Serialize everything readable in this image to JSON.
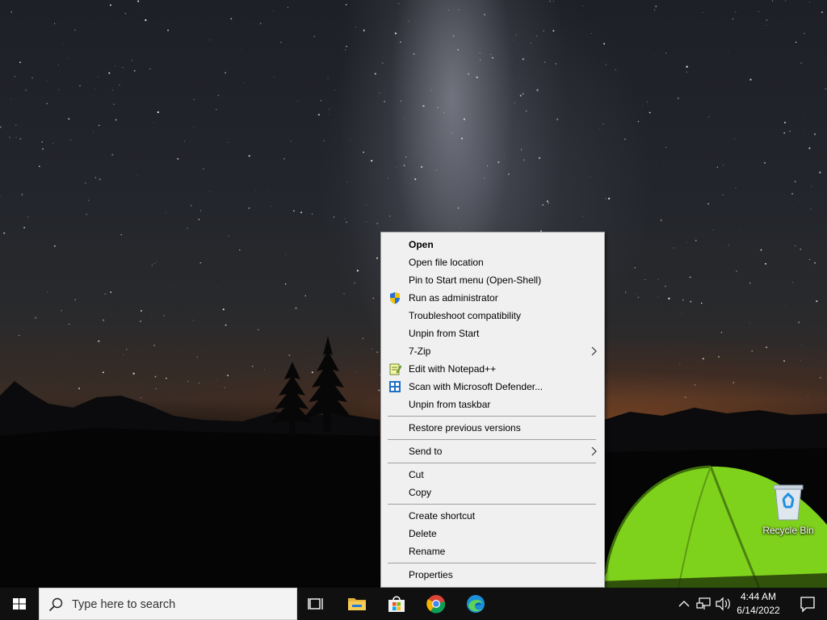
{
  "desktop": {
    "icons": [
      {
        "label": "Recycle Bin",
        "icon": "recycle-bin-icon"
      }
    ]
  },
  "context_menu": {
    "groups": [
      [
        {
          "label": "Open",
          "bold": true
        },
        {
          "label": "Open file location"
        },
        {
          "label": "Pin to Start menu (Open-Shell)"
        },
        {
          "label": "Run as administrator",
          "icon": "uac-shield-icon"
        },
        {
          "label": "Troubleshoot compatibility"
        },
        {
          "label": "Unpin from Start"
        },
        {
          "label": "7-Zip",
          "submenu": true
        },
        {
          "label": "Edit with Notepad++",
          "icon": "notepad-plus-plus-icon"
        },
        {
          "label": "Scan with Microsoft Defender...",
          "icon": "defender-icon"
        },
        {
          "label": "Unpin from taskbar"
        }
      ],
      [
        {
          "label": "Restore previous versions"
        }
      ],
      [
        {
          "label": "Send to",
          "submenu": true
        }
      ],
      [
        {
          "label": "Cut"
        },
        {
          "label": "Copy"
        }
      ],
      [
        {
          "label": "Create shortcut"
        },
        {
          "label": "Delete"
        },
        {
          "label": "Rename"
        }
      ],
      [
        {
          "label": "Properties"
        }
      ]
    ]
  },
  "taskbar": {
    "search_placeholder": "Type here to search",
    "pinned_apps": [
      "task-view-icon",
      "file-explorer-icon",
      "microsoft-store-icon",
      "chrome-icon",
      "edge-icon"
    ],
    "clock": {
      "time": "4:44 AM",
      "date": "6/14/2022"
    }
  },
  "colors": {
    "menu_background": "#f0f0f0",
    "menu_border": "#a0a0a0",
    "taskbar_background": "#101010",
    "tent_green": "#7fd21c"
  }
}
